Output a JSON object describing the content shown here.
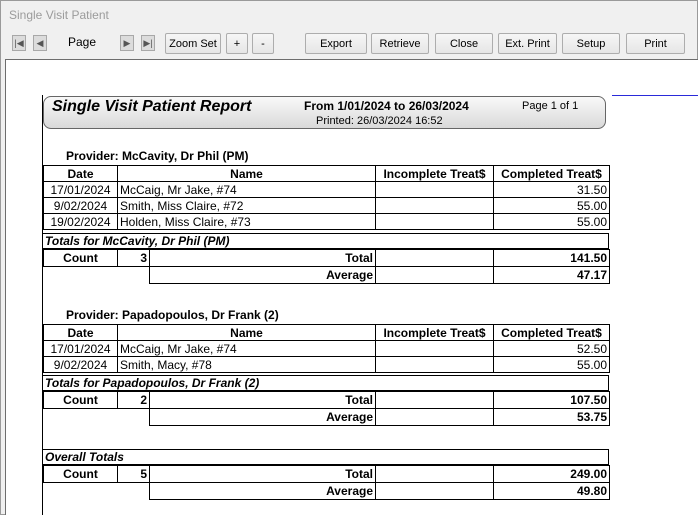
{
  "window": {
    "title": "Single Visit Patient"
  },
  "toolbar": {
    "page_label": "Page",
    "zoom_set": "Zoom Set",
    "zoom_in": "+",
    "zoom_out": "-",
    "export": "Export",
    "retrieve": "Retrieve",
    "close": "Close",
    "ext_print": "Ext. Print",
    "setup": "Setup",
    "print": "Print"
  },
  "report": {
    "title": "Single Visit Patient Report",
    "range": "From 1/01/2024 to 26/03/2024",
    "printed": "Printed: 26/03/2024 16:52",
    "page": "Page 1 of 1",
    "columns": [
      "Date",
      "Name",
      "Incomplete Treat$",
      "Completed Treat$"
    ],
    "count_label": "Count",
    "total_label": "Total",
    "average_label": "Average",
    "providers": [
      {
        "label": "Provider:  McCavity, Dr Phil (PM)",
        "rows": [
          {
            "date": "17/01/2024",
            "name": "McCaig, Mr Jake, #74",
            "incomplete": "",
            "completed": "31.50"
          },
          {
            "date": "9/02/2024",
            "name": "Smith, Miss Claire, #72",
            "incomplete": "",
            "completed": "55.00"
          },
          {
            "date": "19/02/2024",
            "name": "Holden, Miss Claire, #73",
            "incomplete": "",
            "completed": "55.00"
          }
        ],
        "totals_label": "Totals for McCavity, Dr Phil (PM)",
        "count": "3",
        "total": "141.50",
        "average": "47.17"
      },
      {
        "label": "Provider:  Papadopoulos, Dr Frank (2)",
        "rows": [
          {
            "date": "17/01/2024",
            "name": "McCaig, Mr Jake, #74",
            "incomplete": "",
            "completed": "52.50"
          },
          {
            "date": "9/02/2024",
            "name": "Smith, Macy, #78",
            "incomplete": "",
            "completed": "55.00"
          }
        ],
        "totals_label": "Totals for Papadopoulos, Dr Frank (2)",
        "count": "2",
        "total": "107.50",
        "average": "53.75"
      }
    ],
    "overall": {
      "label": "Overall Totals",
      "count": "5",
      "total": "249.00",
      "average": "49.80"
    }
  }
}
